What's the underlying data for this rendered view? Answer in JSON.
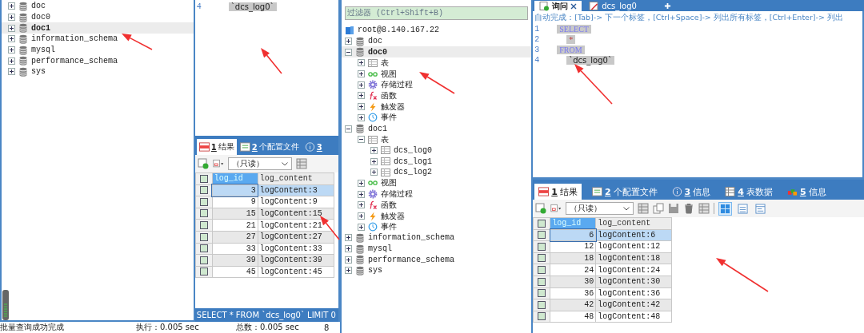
{
  "left_panel": {
    "tree": [
      {
        "label": "doc",
        "kind": "database",
        "expanded": false,
        "selected": false
      },
      {
        "label": "doc0",
        "kind": "database",
        "expanded": false,
        "selected": false
      },
      {
        "label": "doc1",
        "kind": "database",
        "expanded": false,
        "selected": true
      },
      {
        "label": "information_schema",
        "kind": "database",
        "expanded": false,
        "selected": false
      },
      {
        "label": "mysql",
        "kind": "database",
        "expanded": false,
        "selected": false
      },
      {
        "label": "performance_schema",
        "kind": "database",
        "expanded": false,
        "selected": false
      },
      {
        "label": "sys",
        "kind": "database",
        "expanded": false,
        "selected": false
      }
    ]
  },
  "query_panel": {
    "editor_lines": [
      {
        "number": "4",
        "code": "`dcs_log0`",
        "kind": "identifier"
      }
    ],
    "result_tabs": [
      {
        "number": "1",
        "label": "结果",
        "kind": "results",
        "selected": true
      },
      {
        "number": "2",
        "label": "个配置文件",
        "kind": "profile",
        "selected": false
      },
      {
        "number": "3",
        "kind": "info",
        "selected": false
      }
    ],
    "mode": "（只读）",
    "grid": {
      "all_checked": false,
      "columns": [
        "log_id",
        "log_content"
      ],
      "rows": [
        {
          "log_id": "3",
          "log_content": "logContent:3",
          "selected": true,
          "checked": false
        },
        {
          "log_id": "9",
          "log_content": "logContent:9",
          "selected": false,
          "checked": false
        },
        {
          "log_id": "15",
          "log_content": "logContent:15",
          "selected": false,
          "checked": false
        },
        {
          "log_id": "21",
          "log_content": "logContent:21",
          "selected": false,
          "checked": false
        },
        {
          "log_id": "27",
          "log_content": "logContent:27",
          "selected": false,
          "checked": false
        },
        {
          "log_id": "33",
          "log_content": "logContent:33",
          "selected": false,
          "checked": false
        },
        {
          "log_id": "39",
          "log_content": "logContent:39",
          "selected": false,
          "checked": false
        },
        {
          "log_id": "45",
          "log_content": "logContent:45",
          "selected": false,
          "checked": false
        }
      ]
    },
    "sql_status": "SELECT * FROM `dcs_log0` LIMIT 0"
  },
  "status_bar": {
    "message": "批量查询成功完成",
    "execution": "执行：0.005 sec",
    "total": "总数：0.005 sec",
    "rows": "8"
  },
  "object_browser": {
    "filter_placeholder": "过滤器 (Ctrl+Shift+B)",
    "connection": "root@8.140.167.22",
    "tree": [
      {
        "label": "doc",
        "kind": "database",
        "expanded": false,
        "selected": false
      },
      {
        "label": "doc0",
        "kind": "database",
        "expanded": true,
        "selected": true,
        "children": [
          {
            "label": "表",
            "kind": "tables",
            "expanded": false,
            "selected": false
          },
          {
            "label": "视图",
            "kind": "views",
            "expanded": false,
            "selected": false
          },
          {
            "label": "存储过程",
            "kind": "procedures",
            "expanded": false,
            "selected": false
          },
          {
            "label": "函数",
            "kind": "functions",
            "expanded": false,
            "selected": false
          },
          {
            "label": "触发器",
            "kind": "triggers",
            "expanded": false,
            "selected": false
          },
          {
            "label": "事件",
            "kind": "events",
            "expanded": false,
            "selected": false
          }
        ]
      },
      {
        "label": "doc1",
        "kind": "database",
        "expanded": true,
        "selected": false,
        "children": [
          {
            "label": "表",
            "kind": "tables",
            "expanded": true,
            "selected": false,
            "children": [
              {
                "label": "dcs_log0",
                "kind": "table",
                "expanded": false,
                "selected": false
              },
              {
                "label": "dcs_log1",
                "kind": "table",
                "expanded": false,
                "selected": false
              },
              {
                "label": "dcs_log2",
                "kind": "table",
                "expanded": false,
                "selected": false
              }
            ]
          },
          {
            "label": "视图",
            "kind": "views",
            "expanded": false,
            "selected": false
          },
          {
            "label": "存储过程",
            "kind": "procedures",
            "expanded": false,
            "selected": false
          },
          {
            "label": "函数",
            "kind": "functions",
            "expanded": false,
            "selected": false
          },
          {
            "label": "触发器",
            "kind": "triggers",
            "expanded": false,
            "selected": false
          },
          {
            "label": "事件",
            "kind": "events",
            "expanded": false,
            "selected": false
          }
        ]
      },
      {
        "label": "information_schema",
        "kind": "database",
        "expanded": false,
        "selected": false
      },
      {
        "label": "mysql",
        "kind": "database",
        "expanded": false,
        "selected": false
      },
      {
        "label": "performance_schema",
        "kind": "database",
        "expanded": false,
        "selected": false
      },
      {
        "label": "sys",
        "kind": "database",
        "expanded": false,
        "selected": false
      }
    ]
  },
  "right_panel": {
    "editor_tabs": [
      {
        "label": "询问",
        "kind": "query",
        "selected": true
      },
      {
        "label": "dcs_log0",
        "kind": "table-edit",
        "selected": false
      }
    ],
    "hint": "自动完成：[Tab]-> 下一个标签，[Ctrl+Space]-> 列出所有标签，[Ctrl+Enter]-> 列出",
    "editor_lines": [
      {
        "number": "1",
        "code": "SELECT",
        "kind": "keyword"
      },
      {
        "number": "2",
        "code": "*",
        "kind": "operator"
      },
      {
        "number": "3",
        "code": "FROM",
        "kind": "keyword"
      },
      {
        "number": "4",
        "code": "`dcs_log0`",
        "kind": "identifier"
      }
    ],
    "result_tabs": [
      {
        "number": "1",
        "label": "结果",
        "kind": "results",
        "selected": true
      },
      {
        "number": "2",
        "label": "个配置文件",
        "kind": "profile",
        "selected": false
      },
      {
        "number": "3",
        "label": "信息",
        "kind": "info",
        "selected": false
      },
      {
        "number": "4",
        "label": "表数据",
        "kind": "table-data",
        "selected": false
      },
      {
        "number": "5",
        "label": "信息",
        "kind": "messages",
        "selected": false
      }
    ],
    "mode": "（只读）",
    "view_modes": [
      {
        "kind": "grid",
        "selected": true
      },
      {
        "kind": "form",
        "selected": false
      },
      {
        "kind": "text",
        "selected": false
      }
    ],
    "grid": {
      "all_checked": false,
      "columns": [
        "log_id",
        "log_content"
      ],
      "rows": [
        {
          "log_id": "6",
          "log_content": "logContent:6",
          "selected": true,
          "checked": false
        },
        {
          "log_id": "12",
          "log_content": "logContent:12",
          "selected": false,
          "checked": false
        },
        {
          "log_id": "18",
          "log_content": "logContent:18",
          "selected": false,
          "checked": false
        },
        {
          "log_id": "24",
          "log_content": "logContent:24",
          "selected": false,
          "checked": false
        },
        {
          "log_id": "30",
          "log_content": "logContent:30",
          "selected": false,
          "checked": false
        },
        {
          "log_id": "36",
          "log_content": "logContent:36",
          "selected": false,
          "checked": false
        },
        {
          "log_id": "42",
          "log_content": "logContent:42",
          "selected": false,
          "checked": false
        },
        {
          "log_id": "48",
          "log_content": "logContent:48",
          "selected": false,
          "checked": false
        }
      ]
    }
  }
}
